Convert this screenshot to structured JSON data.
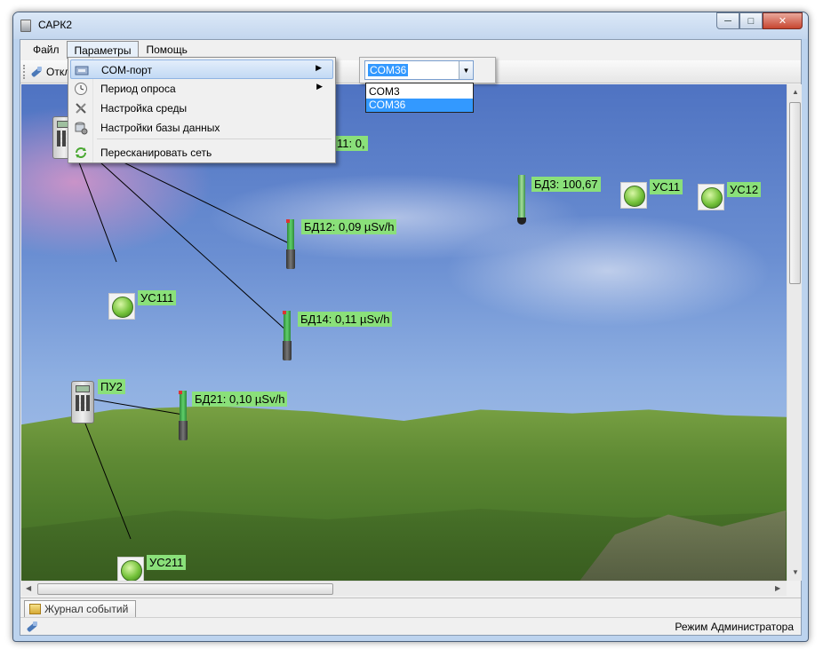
{
  "window": {
    "title": "САРК2"
  },
  "menubar": {
    "items": [
      "Файл",
      "Параметры",
      "Помощь"
    ]
  },
  "toolbar": {
    "disconnect_label": "Откл"
  },
  "params_menu": {
    "items": [
      {
        "label": "COM-порт",
        "icon": "com-port-icon",
        "submenu": true
      },
      {
        "label": "Период опроса",
        "icon": "clock-icon",
        "submenu": true
      },
      {
        "label": "Настройка среды",
        "icon": "tools-icon",
        "submenu": false
      },
      {
        "label": "Настройки базы данных",
        "icon": "database-settings-icon",
        "submenu": false
      },
      {
        "label": "Пересканировать сеть",
        "icon": "refresh-icon",
        "submenu": false
      }
    ]
  },
  "com_port": {
    "selected": "COM36",
    "options": [
      "COM3",
      "COM36"
    ]
  },
  "network": {
    "nodes": [
      {
        "id": "bd12",
        "type": "sensor",
        "label": "БД12: 0,09 µSv/h"
      },
      {
        "id": "bd14",
        "type": "sensor",
        "label": "БД14: 0,11 µSv/h"
      },
      {
        "id": "bd21",
        "type": "sensor",
        "label": "БД21: 0,10 µSv/h"
      },
      {
        "id": "bd3",
        "type": "sensor",
        "label": "БД3: 100,67"
      },
      {
        "id": "bd11_partial",
        "type": "label",
        "label": "11: 0,"
      },
      {
        "id": "us111",
        "type": "unit",
        "label": "УС111"
      },
      {
        "id": "us11",
        "type": "unit",
        "label": "УС11"
      },
      {
        "id": "us12",
        "type": "unit",
        "label": "УС12"
      },
      {
        "id": "us211",
        "type": "unit",
        "label": "УС211"
      },
      {
        "id": "pu2",
        "type": "console",
        "label": "ПУ2"
      }
    ]
  },
  "tabs": [
    {
      "label": "Журнал событий"
    }
  ],
  "status": {
    "mode": "Режим Администратора"
  },
  "colors": {
    "node_label_bg": "#8ae07a",
    "selection": "#3399ff",
    "menu_highlight": "#c2d9f4"
  }
}
